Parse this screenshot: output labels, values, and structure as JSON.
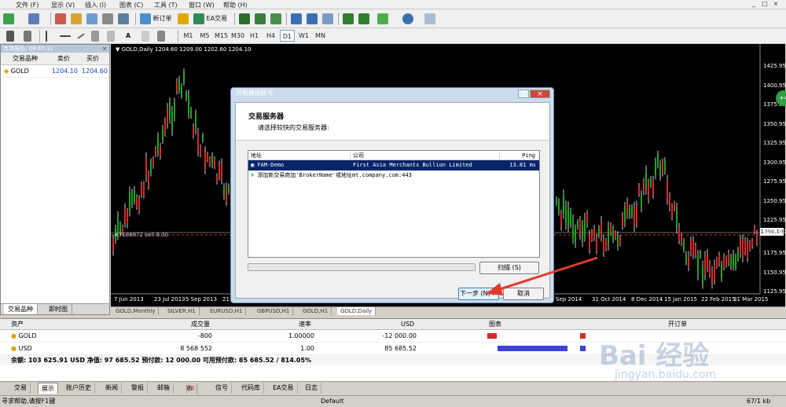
{
  "menu": {
    "items": [
      "文件 (F)",
      "显示 (V)",
      "插入 (I)",
      "图表 (C)",
      "工具 (T)",
      "窗口 (W)",
      "帮助 (H)"
    ],
    "win_min": "_",
    "win_max": "□",
    "win_close": "×"
  },
  "toolbar": {
    "new_order": "新订单",
    "ea_trade": "EA交易"
  },
  "timeframes": [
    "M1",
    "M5",
    "M15",
    "M30",
    "H1",
    "H4",
    "D1",
    "W1",
    "MN"
  ],
  "toolbar2": {
    "text_tool": "A"
  },
  "market_watch": {
    "title": "市场报价: 09:47:31",
    "close": "×",
    "columns": [
      "交易品种",
      "卖价",
      "买价"
    ],
    "rows": [
      {
        "symbol": "GOLD",
        "bid": "1204.10",
        "ask": "1204.60"
      }
    ],
    "tabs": [
      "交易品种",
      "即时图"
    ]
  },
  "chart": {
    "header": "GOLD,Daily  1204.60 1209.00 1202.60 1204.10",
    "order_line": "#7186872 sell 8.00",
    "price_tag": "1204.10",
    "price_levels": [
      "1425.95",
      "1400.95",
      "1375.95",
      "1350.95",
      "1325.95",
      "1300.95",
      "1275.95",
      "1250.95",
      "1225.95",
      "1204.10",
      "1175.95",
      "1150.95",
      "1125.95"
    ],
    "dates_left": [
      "7 Jun 2013",
      "23 Jul 2013",
      "5 Sep 2013",
      "21"
    ],
    "dates_right": [
      "Sep 2014",
      "31 Oct 2014",
      "8 Dec 2014",
      "15 Jan 2015",
      "22 Feb 2015",
      "31 Mar 2015"
    ],
    "tabs": [
      "GOLD,Monthly",
      "SILVER,H1",
      "EURUSD,H1",
      "GBPUSD,H1",
      "GOLD,H1",
      "GOLD,Daily"
    ],
    "badge": "+4"
  },
  "dialog": {
    "title": "开新模拟帐号",
    "h1": "交易服务器",
    "h2": "请选择较快的交易服务器:",
    "columns": [
      "地址",
      "公司",
      "Ping"
    ],
    "rows": [
      {
        "address": "FAM-Demo",
        "company": "First Asia Merchants Bullion Limited",
        "ping": "13.81 ms"
      }
    ],
    "add_row": "添加新交易商加'BrokerName'或地址mt.company.com:443",
    "scan": "扫描 (S)",
    "next": "下一步 (N) >",
    "cancel": "取消",
    "btn_min": "?",
    "btn_close": "×"
  },
  "terminal": {
    "columns": [
      "资产",
      "成交量",
      "速率",
      "USD",
      "图表",
      "开订单"
    ],
    "rows": [
      {
        "asset": "GOLD",
        "volume": "-800",
        "rate": "1.00000",
        "usd": "-12 000.00"
      },
      {
        "asset": "USD",
        "volume": "8 568 552",
        "rate": "1.00",
        "usd": "85 685.52"
      }
    ],
    "summary": "余额: 103 625.91 USD  净值: 97 685.52  预付款: 12 000.00  可用预付款: 85 685.52 / 814.05%"
  },
  "bottom_tabs": [
    "交易",
    "展示",
    "账户历史",
    "新闻",
    "警报",
    "邮箱",
    "市场",
    "信号",
    "代码库",
    "EA交易",
    "日志"
  ],
  "market_badge": "73",
  "status": {
    "help": "寻求帮助,请按F1键",
    "profile": "Default",
    "traffic": "67/1 kb"
  },
  "watermark": {
    "main": "Bai 经验",
    "sub": "jingyan.baidu.com"
  }
}
